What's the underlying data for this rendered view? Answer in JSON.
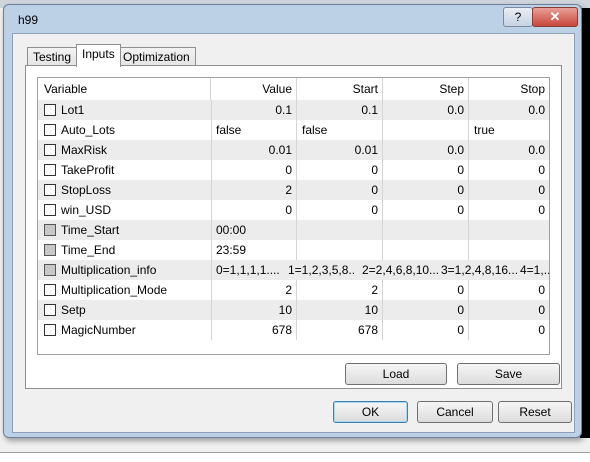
{
  "window": {
    "title": "h99",
    "help_label": "?",
    "close_label": "✕"
  },
  "tabs": [
    {
      "label": "Testing",
      "active": false
    },
    {
      "label": "Inputs",
      "active": true
    },
    {
      "label": "Optimization",
      "active": false
    }
  ],
  "table": {
    "headers": [
      "Variable",
      "Value",
      "Start",
      "Step",
      "Stop"
    ],
    "rows": [
      {
        "name": "Lot1",
        "value": "0.1",
        "start": "0.1",
        "step": "0.0",
        "stop": "0.0",
        "checkbox": "enabled"
      },
      {
        "name": "Auto_Lots",
        "value": "false",
        "start": "false",
        "step": "",
        "stop": "true",
        "checkbox": "enabled"
      },
      {
        "name": "MaxRisk",
        "value": "0.01",
        "start": "0.01",
        "step": "0.0",
        "stop": "0.0",
        "checkbox": "enabled"
      },
      {
        "name": "TakeProfit",
        "value": "0",
        "start": "0",
        "step": "0",
        "stop": "0",
        "checkbox": "enabled"
      },
      {
        "name": "StopLoss",
        "value": "2",
        "start": "0",
        "step": "0",
        "stop": "0",
        "checkbox": "enabled"
      },
      {
        "name": "win_USD",
        "value": "0",
        "start": "0",
        "step": "0",
        "stop": "0",
        "checkbox": "enabled"
      },
      {
        "name": "Time_Start",
        "value": "00:00",
        "start": "",
        "step": "",
        "stop": "",
        "checkbox": "disabled"
      },
      {
        "name": "Time_End",
        "value": "23:59",
        "start": "",
        "step": "",
        "stop": "",
        "checkbox": "disabled"
      },
      {
        "name": "Multiplication_info",
        "value": "0=1,1,1,1....",
        "start": "1=1,2,3,5,8....",
        "step": "2=2,4,6,8,10....",
        "stop": "3=1,2,4,8,16....",
        "extra": "4=1,...",
        "checkbox": "disabled"
      },
      {
        "name": "Multiplication_Mode",
        "value": "2",
        "start": "2",
        "step": "0",
        "stop": "0",
        "checkbox": "enabled"
      },
      {
        "name": "Setp",
        "value": "10",
        "start": "10",
        "step": "0",
        "stop": "0",
        "checkbox": "enabled"
      },
      {
        "name": "MagicNumber",
        "value": "678",
        "start": "678",
        "step": "0",
        "stop": "0",
        "checkbox": "enabled"
      }
    ]
  },
  "buttons": {
    "load": "Load",
    "save": "Save",
    "ok": "OK",
    "cancel": "Cancel",
    "reset": "Reset"
  }
}
